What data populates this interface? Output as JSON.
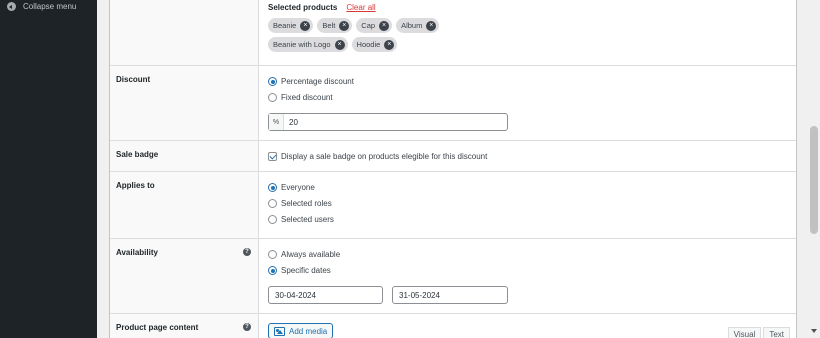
{
  "sidebar": {
    "collapse_label": "Collapse menu"
  },
  "products": {
    "title": "Selected products",
    "clear_label": "Clear all",
    "chips": [
      "Beanie",
      "Belt",
      "Cap",
      "Album",
      "Beanie with Logo",
      "Hoodie"
    ],
    "remove_glyph": "×"
  },
  "discount": {
    "label": "Discount",
    "options": [
      "Percentage discount",
      "Fixed discount"
    ],
    "selected": "Percentage discount",
    "prefix": "%",
    "value": "20"
  },
  "sale_badge": {
    "label": "Sale badge",
    "checkbox_label": "Display a sale badge on products elegible for this discount",
    "checked": true
  },
  "applies_to": {
    "label": "Applies to",
    "options": [
      "Everyone",
      "Selected roles",
      "Selected users"
    ],
    "selected": "Everyone"
  },
  "availability": {
    "label": "Availability",
    "help": "?",
    "options": [
      "Always available",
      "Specific dates"
    ],
    "selected": "Specific dates",
    "start_date": "30-04-2024",
    "end_date": "31-05-2024"
  },
  "product_page": {
    "label": "Product page content",
    "help": "?",
    "add_media_label": "Add media",
    "tabs": [
      "Visual",
      "Text"
    ]
  },
  "colors": {
    "accent": "#2271b1",
    "danger": "#d63638",
    "sidebar": "#1d2327"
  }
}
